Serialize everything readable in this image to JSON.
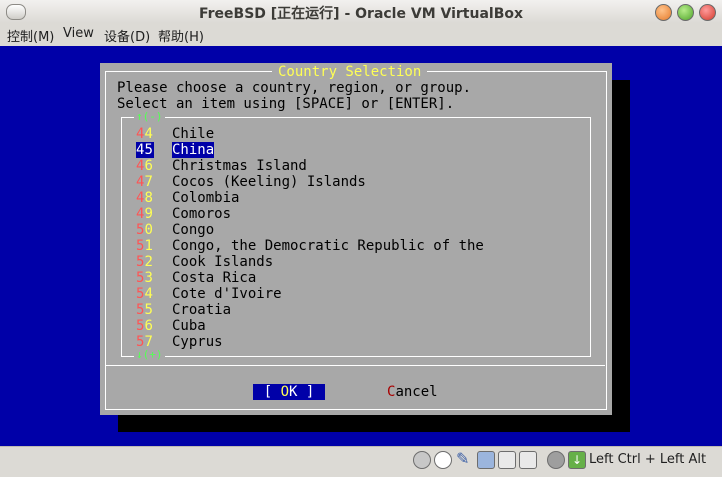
{
  "window": {
    "title": "FreeBSD [正在运行] - Oracle VM VirtualBox"
  },
  "menubar": {
    "items": [
      "控制(M)",
      "View",
      "设备(D)",
      "帮助(H)"
    ]
  },
  "dialog": {
    "title": "Country Selection",
    "prompt_line1": "Please choose a country, region, or group.",
    "prompt_line2": "Select an item using [SPACE] or [ENTER].",
    "scroll_up": "↑(-)",
    "scroll_down": "↓(+)",
    "items": [
      {
        "d1": "4",
        "d2": "4",
        "name": "Chile"
      },
      {
        "d1": "4",
        "d2": "5",
        "name": "China"
      },
      {
        "d1": "4",
        "d2": "6",
        "name": "Christmas Island"
      },
      {
        "d1": "4",
        "d2": "7",
        "name": "Cocos (Keeling) Islands"
      },
      {
        "d1": "4",
        "d2": "8",
        "name": "Colombia"
      },
      {
        "d1": "4",
        "d2": "9",
        "name": "Comoros"
      },
      {
        "d1": "5",
        "d2": "0",
        "name": "Congo"
      },
      {
        "d1": "5",
        "d2": "1",
        "name": "Congo, the Democratic Republic of the"
      },
      {
        "d1": "5",
        "d2": "2",
        "name": "Cook Islands"
      },
      {
        "d1": "5",
        "d2": "3",
        "name": "Costa Rica"
      },
      {
        "d1": "5",
        "d2": "4",
        "name": "Cote d'Ivoire"
      },
      {
        "d1": "5",
        "d2": "5",
        "name": "Croatia"
      },
      {
        "d1": "5",
        "d2": "6",
        "name": "Cuba"
      },
      {
        "d1": "5",
        "d2": "7",
        "name": "Cyprus"
      }
    ],
    "ok_left": "[ ",
    "ok_hot": "O",
    "ok_rest": "K ]",
    "cancel_hot": "C",
    "cancel_rest": "ancel"
  },
  "statusbar": {
    "host_key": "Left Ctrl + Left Alt"
  }
}
